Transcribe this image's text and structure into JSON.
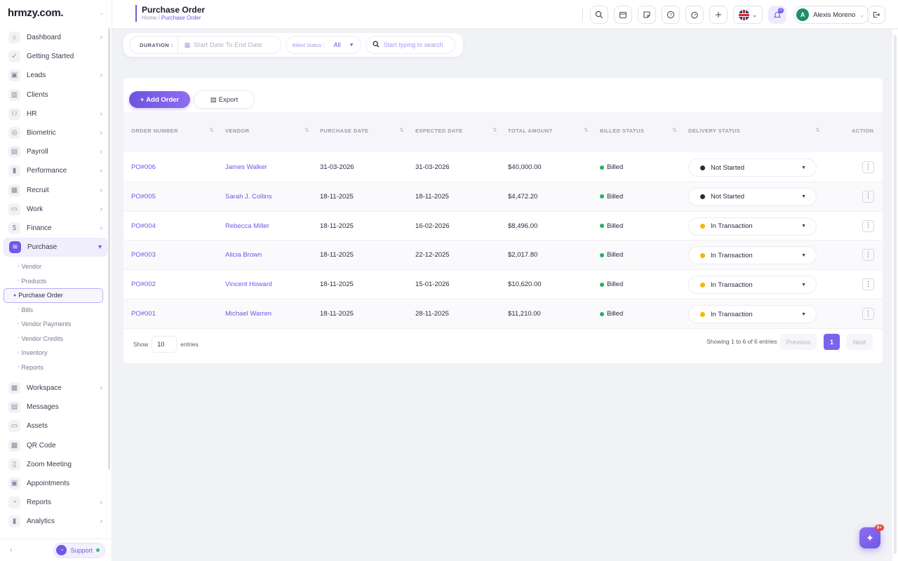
{
  "brand": {
    "logo": "hrmzy.com."
  },
  "sidebar": {
    "items": [
      {
        "label": "Dashboard",
        "icon": "home-icon",
        "glyph": "⌂",
        "has_caret": true
      },
      {
        "label": "Getting Started",
        "icon": "check-circle-icon",
        "glyph": "✓",
        "has_caret": false
      },
      {
        "label": "Leads",
        "icon": "contact-card-icon",
        "glyph": "▣",
        "has_caret": true
      },
      {
        "label": "Clients",
        "icon": "bar-chart-icon",
        "glyph": "▥",
        "has_caret": false
      },
      {
        "label": "HR",
        "icon": "users-icon",
        "glyph": "⚇",
        "has_caret": true
      },
      {
        "label": "Biometric",
        "icon": "fingerprint-icon",
        "glyph": "◎",
        "has_caret": true
      },
      {
        "label": "Payroll",
        "icon": "calendar-icon",
        "glyph": "▤",
        "has_caret": true
      },
      {
        "label": "Performance",
        "icon": "performance-chart-icon",
        "glyph": "▮",
        "has_caret": true
      },
      {
        "label": "Recruit",
        "icon": "recruit-icon",
        "glyph": "▦",
        "has_caret": true
      },
      {
        "label": "Work",
        "icon": "briefcase-icon",
        "glyph": "▭",
        "has_caret": true
      },
      {
        "label": "Finance",
        "icon": "dollar-icon",
        "glyph": "$",
        "has_caret": true
      },
      {
        "label": "Purchase",
        "icon": "layers-icon",
        "glyph": "≋",
        "has_caret": true,
        "active": true
      }
    ],
    "purchase_sub": [
      "Vendor",
      "Products",
      "Purchase Order",
      "Bills",
      "Vendor Payments",
      "Vendor Credits",
      "Inventory",
      "Reports"
    ],
    "purchase_sub_active": "Purchase Order",
    "items_after": [
      {
        "label": "Workspace",
        "icon": "grid-icon",
        "glyph": "▦",
        "has_caret": true
      },
      {
        "label": "Messages",
        "icon": "message-icon",
        "glyph": "▤",
        "has_caret": false
      },
      {
        "label": "Assets",
        "icon": "monitor-icon",
        "glyph": "▭",
        "has_caret": false
      },
      {
        "label": "QR Code",
        "icon": "qr-code-icon",
        "glyph": "▩",
        "has_caret": false
      },
      {
        "label": "Zoom Meeting",
        "icon": "video-icon",
        "glyph": "▯",
        "has_caret": false
      },
      {
        "label": "Appointments",
        "icon": "calendar-check-icon",
        "glyph": "▣",
        "has_caret": false
      },
      {
        "label": "Reports",
        "icon": "pie-chart-icon",
        "glyph": "◔",
        "has_caret": true
      },
      {
        "label": "Analytics",
        "icon": "analytics-icon",
        "glyph": "▮",
        "has_caret": true
      }
    ],
    "support_label": "Support"
  },
  "header": {
    "title": "Purchase Order",
    "breadcrumb_home": "Home",
    "breadcrumb_sep": "/",
    "breadcrumb_current": "Purchase Order",
    "user_initial": "A",
    "user_name": "Alexis Moreno"
  },
  "filters": {
    "duration_label": "DURATION :",
    "date_placeholder": "Start Date To End Date",
    "billed_label": "Billed Status :",
    "billed_value": "All",
    "search_placeholder": "Start typing to search"
  },
  "toolbar": {
    "add_label": "Add Order",
    "export_label": "Export"
  },
  "table": {
    "columns": [
      "ORDER NUMBER",
      "VENDOR",
      "PURCHASE DATE",
      "EXPECTED DATE",
      "TOTAL AMOUNT",
      "BILLED STATUS",
      "DELIVERY STATUS",
      "ACTION"
    ],
    "rows": [
      {
        "order": "PO#006",
        "vendor": "James Walker",
        "purchase_date": "31-03-2026",
        "expected_date": "31-03-2026",
        "amount": "$40,000.00",
        "billed": "Billed",
        "delivery": "Not Started",
        "delivery_color": "#2a2a3a"
      },
      {
        "order": "PO#005",
        "vendor": "Sarah J. Collins",
        "purchase_date": "18-11-2025",
        "expected_date": "18-11-2025",
        "amount": "$4,472.20",
        "billed": "Billed",
        "delivery": "Not Started",
        "delivery_color": "#2a2a3a"
      },
      {
        "order": "PO#004",
        "vendor": "Rebecca Miller",
        "purchase_date": "18-11-2025",
        "expected_date": "16-02-2026",
        "amount": "$8,496.00",
        "billed": "Billed",
        "delivery": "In Transaction",
        "delivery_color": "#f5b800"
      },
      {
        "order": "PO#003",
        "vendor": "Alicia Brown",
        "purchase_date": "18-11-2025",
        "expected_date": "22-12-2025",
        "amount": "$2,017.80",
        "billed": "Billed",
        "delivery": "In Transaction",
        "delivery_color": "#f5b800"
      },
      {
        "order": "PO#002",
        "vendor": "Vincent Howard",
        "purchase_date": "18-11-2025",
        "expected_date": "15-01-2026",
        "amount": "$10,620.00",
        "billed": "Billed",
        "delivery": "In Transaction",
        "delivery_color": "#f5b800"
      },
      {
        "order": "PO#001",
        "vendor": "Michael Warren",
        "purchase_date": "18-11-2025",
        "expected_date": "28-11-2025",
        "amount": "$11,210.00",
        "billed": "Billed",
        "delivery": "In Transaction",
        "delivery_color": "#f5b800"
      }
    ]
  },
  "pagination": {
    "show_label": "Show",
    "page_size": "10",
    "entries_label": "entries",
    "info": "Showing 1 to 6 of 6 entries",
    "prev": "Previous",
    "current": "1",
    "next": "Next"
  },
  "fab_badge": "9+",
  "colors": {
    "accent": "#6f58e8",
    "billed": "#1fb45a",
    "not_started": "#2a2a3a",
    "in_transaction": "#f5b800"
  }
}
